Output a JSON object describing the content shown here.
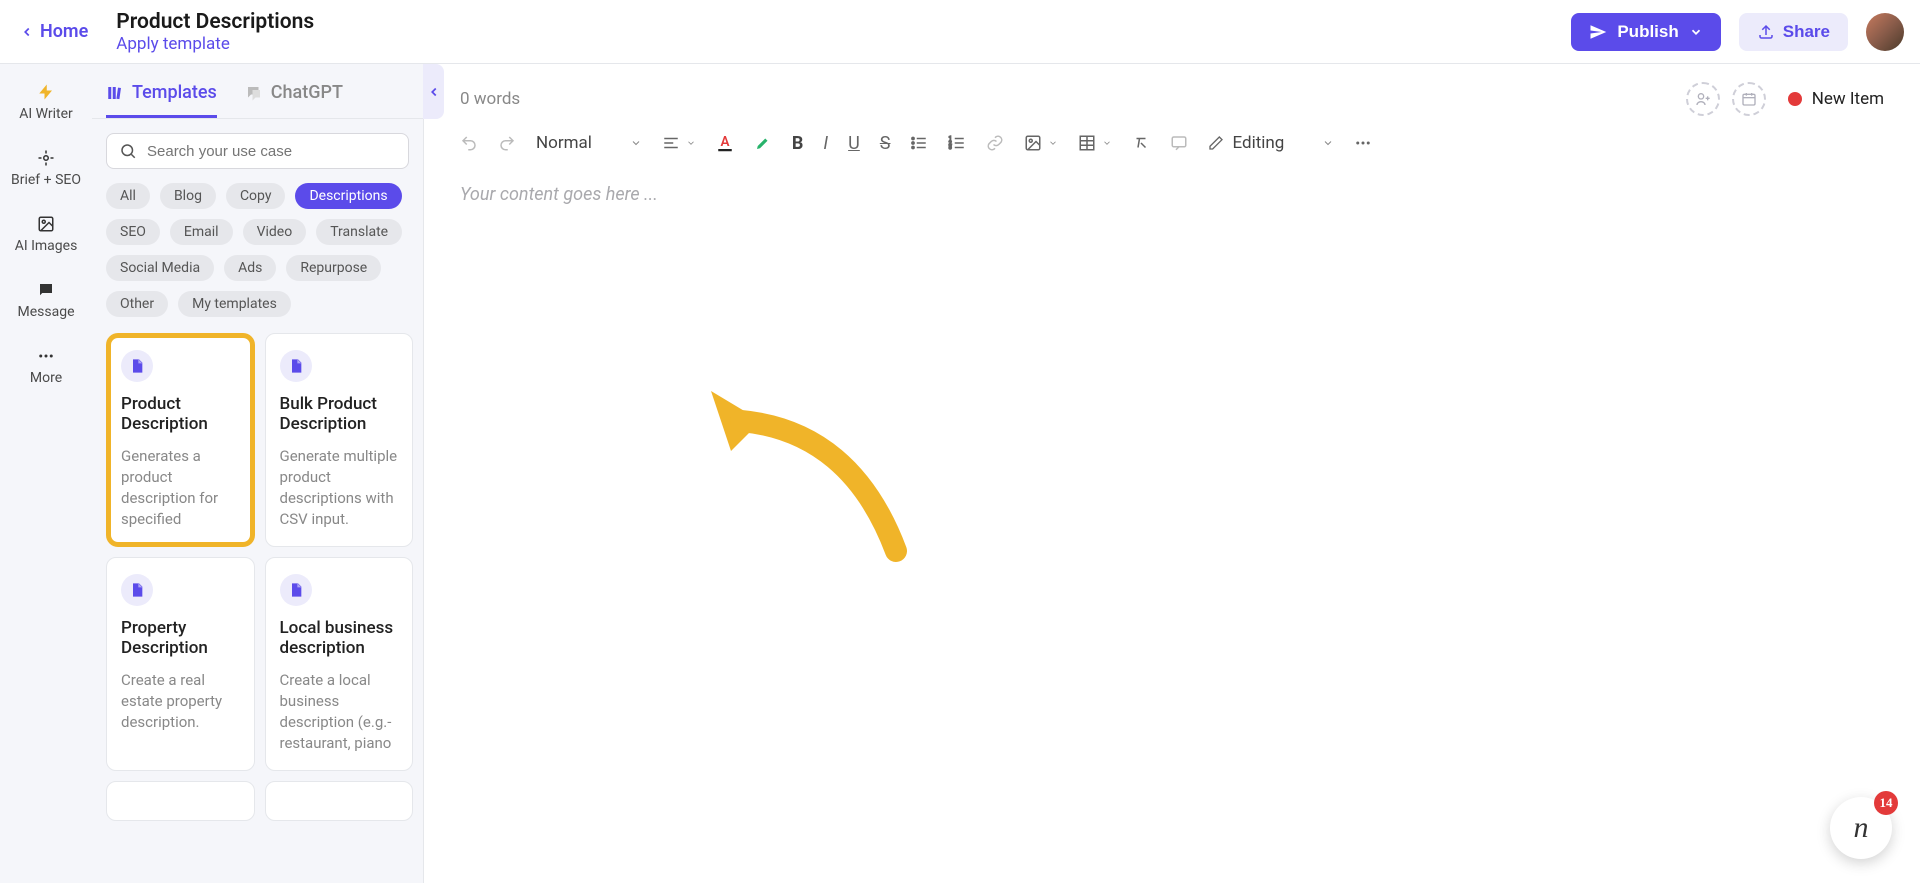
{
  "header": {
    "home": "Home",
    "title": "Product Descriptions",
    "apply_template": "Apply template",
    "publish": "Publish",
    "share": "Share"
  },
  "left_rail": {
    "items": [
      "AI Writer",
      "Brief + SEO",
      "AI Images",
      "Message",
      "More"
    ]
  },
  "panel": {
    "tabs": {
      "templates": "Templates",
      "chatgpt": "ChatGPT"
    },
    "search_placeholder": "Search your use case",
    "filters": [
      "All",
      "Blog",
      "Copy",
      "Descriptions",
      "SEO",
      "Email",
      "Video",
      "Translate",
      "Social Media",
      "Ads",
      "Repurpose",
      "Other",
      "My templates"
    ],
    "active_filter": "Descriptions",
    "templates": [
      {
        "title": "Product Description",
        "desc": "Generates a product description for specified",
        "highlight": true
      },
      {
        "title": "Bulk Product Description",
        "desc": "Generate multiple product descriptions with CSV input.",
        "highlight": false
      },
      {
        "title": "Property Description",
        "desc": "Create a real estate property description.",
        "highlight": false
      },
      {
        "title": "Local business description",
        "desc": "Create a local business description (e.g.- restaurant, piano",
        "highlight": false
      }
    ]
  },
  "editor": {
    "word_count": "0 words",
    "status_label": "New Item",
    "format_select": "Normal",
    "edit_select": "Editing",
    "placeholder": "Your content goes here ..."
  },
  "fab": {
    "badge": "14"
  }
}
